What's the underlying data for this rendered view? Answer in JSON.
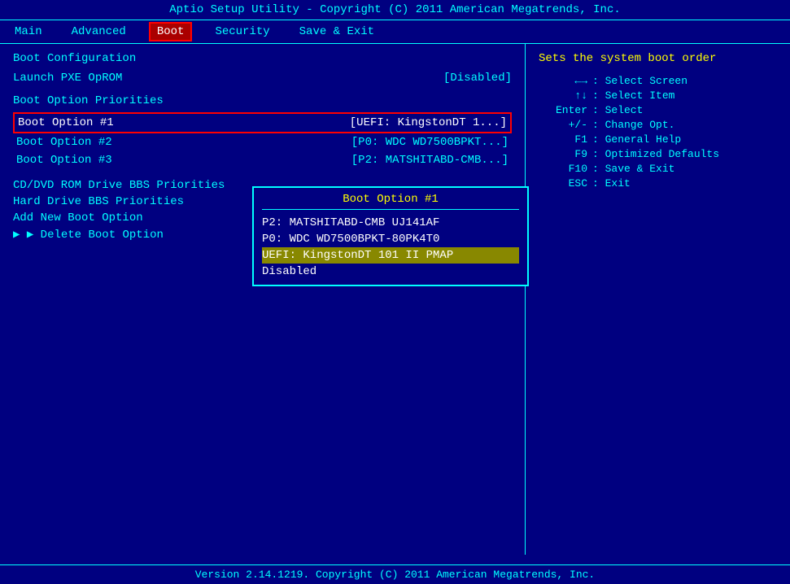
{
  "titleBar": {
    "text": "Aptio Setup Utility - Copyright (C) 2011 American Megatrends, Inc."
  },
  "menuBar": {
    "items": [
      {
        "id": "main",
        "label": "Main",
        "active": false
      },
      {
        "id": "advanced",
        "label": "Advanced",
        "active": false
      },
      {
        "id": "boot",
        "label": "Boot",
        "active": true
      },
      {
        "id": "security",
        "label": "Security",
        "active": false
      },
      {
        "id": "save-exit",
        "label": "Save & Exit",
        "active": false
      }
    ]
  },
  "leftPanel": {
    "sections": [
      {
        "id": "boot-config",
        "title": "Boot Configuration",
        "rows": [
          {
            "label": "Launch PXE OpROM",
            "value": "[Disabled]"
          }
        ]
      },
      {
        "id": "boot-priorities",
        "title": "Boot Option Priorities",
        "bootOptions": [
          {
            "label": "Boot Option #1",
            "value": "[UEFI: KingstonDT 1...]",
            "selected": true
          },
          {
            "label": "Boot Option #2",
            "value": "[P0: WDC WD7500BPKT...]"
          },
          {
            "label": "Boot Option #3",
            "value": "[P2: MATSHITABD-CMB...]"
          }
        ]
      },
      {
        "id": "drives",
        "links": [
          {
            "label": "CD/DVD ROM Drive BBS Priorities",
            "arrow": false
          },
          {
            "label": "Hard Drive BBS Priorities",
            "arrow": false
          },
          {
            "label": "Add New Boot Option",
            "arrow": false
          },
          {
            "label": "Delete Boot Option",
            "arrow": true
          }
        ]
      }
    ]
  },
  "dropdown": {
    "title": "Boot Option #1",
    "options": [
      {
        "label": "P2: MATSHITABD-CMB UJ141AF",
        "highlighted": false
      },
      {
        "label": "P0: WDC WD7500BPKT-80PK4T0",
        "highlighted": false
      },
      {
        "label": "UEFI: KingstonDT 101 II PMAP",
        "highlighted": true
      },
      {
        "label": "Disabled",
        "highlighted": false
      }
    ]
  },
  "rightPanel": {
    "helpText": "Sets the system boot order",
    "keys": [
      {
        "key": "←→",
        "desc": ": Select Screen"
      },
      {
        "key": "↑↓",
        "desc": ": Select Item"
      },
      {
        "key": "Enter",
        "desc": ": Select"
      },
      {
        "key": "+/-",
        "desc": ": Change Opt."
      },
      {
        "key": "F1",
        "desc": ": General Help"
      },
      {
        "key": "F9",
        "desc": ": Optimized Defaults"
      },
      {
        "key": "F10",
        "desc": ": Save & Exit"
      },
      {
        "key": "ESC",
        "desc": ": Exit"
      }
    ]
  },
  "bottomBar": {
    "text": "Version 2.14.1219. Copyright (C) 2011 American Megatrends, Inc."
  }
}
